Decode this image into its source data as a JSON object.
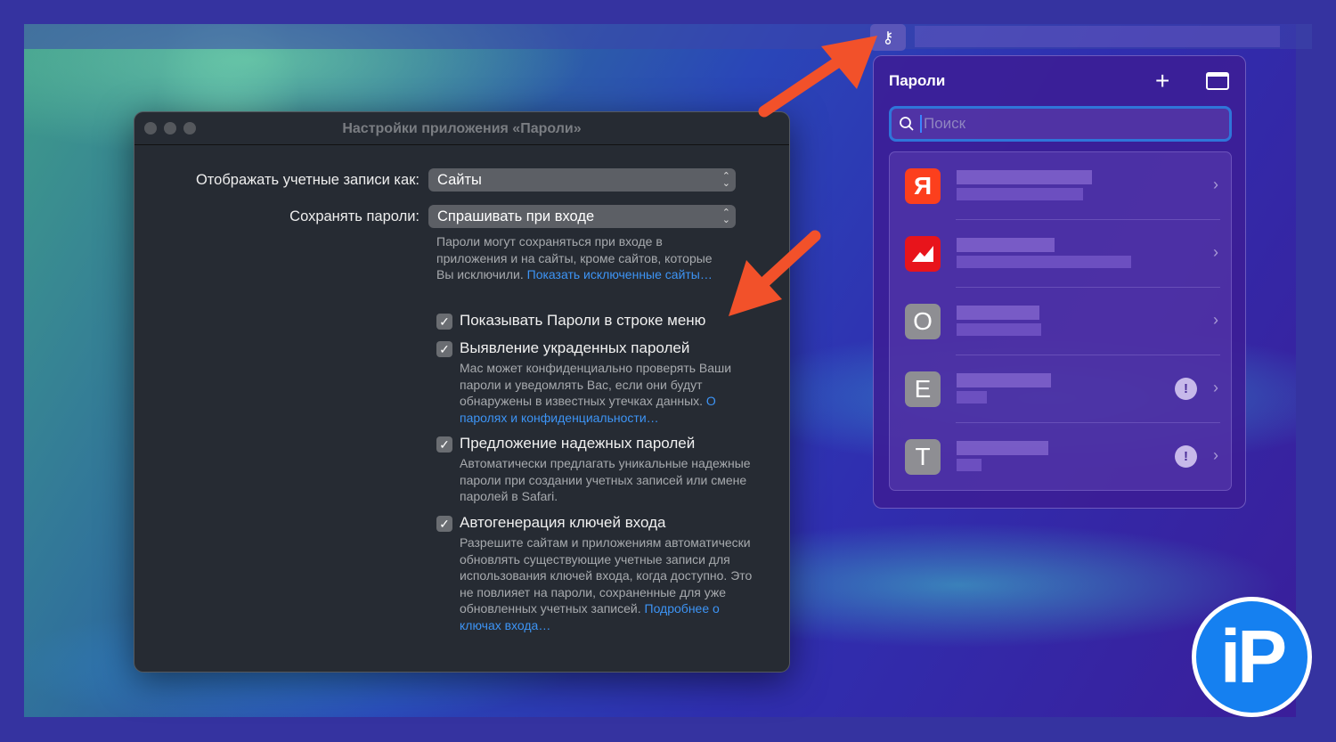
{
  "settings_window": {
    "title": "Настройки приложения «Пароли»",
    "display_label": "Отображать учетные записи как:",
    "display_value": "Сайты",
    "save_label": "Сохранять пароли:",
    "save_value": "Спрашивать при входе",
    "save_help": "Пароли могут сохраняться при входе в приложения и на сайты, кроме сайтов, которые Вы исключили.",
    "save_help_link": "Показать исключенные сайты…",
    "checkboxes": [
      {
        "label": "Показывать Пароли в строке меню",
        "checked": true
      },
      {
        "label": "Выявление украденных паролей",
        "checked": true,
        "desc": "Mac может конфиденциально проверять Ваши пароли и уведомлять Вас, если они будут обнаружены в известных утечках данных.",
        "link": "О паролях и конфиденциальности…"
      },
      {
        "label": "Предложение надежных паролей",
        "checked": true,
        "desc": "Автоматически предлагать уникальные надежные пароли при создании учетных записей или смене паролей в Safari."
      },
      {
        "label": "Автогенерация ключей входа",
        "checked": true,
        "desc": "Разрешите сайтам и приложениям автоматически обновлять существующие учетные записи для использования ключей входа, когда доступно. Это не повлияет на пароли, сохраненные для уже обновленных учетных записей.",
        "link": "Подробнее о ключах входа…"
      }
    ]
  },
  "popup": {
    "title": "Пароли",
    "search_placeholder": "Поиск",
    "items": [
      {
        "icon_letter": "Я",
        "color": "#fc3f1d",
        "warning": false
      },
      {
        "icon_letter": "",
        "color": "#e8141b",
        "warning": false
      },
      {
        "icon_letter": "O",
        "color": "#8e8e93",
        "warning": false
      },
      {
        "icon_letter": "E",
        "color": "#8e8e93",
        "warning": true
      },
      {
        "icon_letter": "T",
        "color": "#8e8e93",
        "warning": true
      }
    ],
    "warning_symbol": "!"
  },
  "logo": {
    "text": "iP"
  }
}
